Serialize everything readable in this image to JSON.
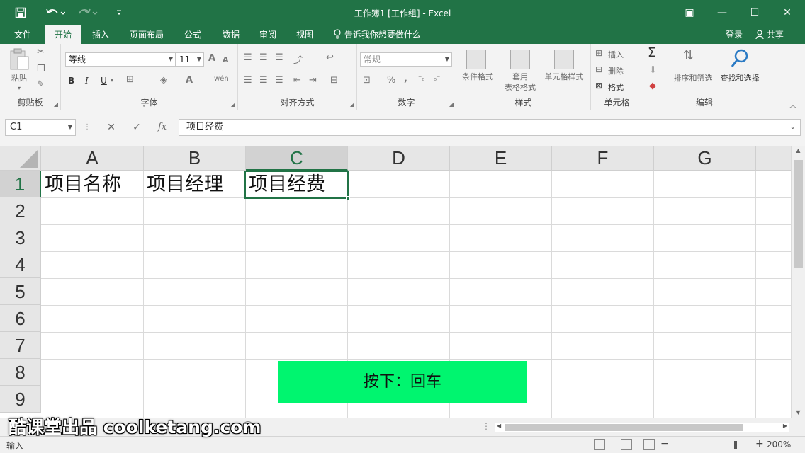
{
  "window": {
    "title": "工作簿1  [工作组] - Excel",
    "quick_access": {
      "save_icon": "save-icon",
      "undo_icon": "undo-icon",
      "redo_icon": "redo-icon",
      "customize_icon": "customize-icon"
    },
    "controls": {
      "ribbon_options": "▣",
      "minimize": "—",
      "maximize": "☐",
      "close": "✕"
    }
  },
  "menu": {
    "tabs": [
      "文件",
      "开始",
      "插入",
      "页面布局",
      "公式",
      "数据",
      "审阅",
      "视图"
    ],
    "active_tab": "开始",
    "tell_me": "告诉我你想要做什么",
    "login": "登录",
    "share": "共享"
  },
  "ribbon": {
    "clipboard": {
      "label": "剪贴板",
      "paste": "粘贴"
    },
    "font": {
      "label": "字体",
      "font_name": "等线",
      "font_size": "11",
      "bold": "B",
      "italic": "I",
      "underline": "U",
      "grow": "A",
      "shrink": "A",
      "font_color": "A",
      "phonetic": "wén"
    },
    "alignment": {
      "label": "对齐方式"
    },
    "number": {
      "label": "数字",
      "format": "常规",
      "percent": "%",
      "comma": ","
    },
    "styles": {
      "label": "样式",
      "conditional": "条件格式",
      "table_format_1": "套用",
      "table_format_2": "表格格式",
      "cell_styles": "单元格样式"
    },
    "cells": {
      "label": "单元格",
      "insert": "插入",
      "delete": "删除",
      "format": "格式"
    },
    "editing": {
      "label": "编辑",
      "sort_filter": "排序和筛选",
      "find_select": "查找和选择",
      "sum": "Σ"
    }
  },
  "formula_bar": {
    "name_box": "C1",
    "cancel": "✕",
    "enter": "✓",
    "fx": "fx",
    "content": "项目经费"
  },
  "sheet": {
    "columns": [
      "A",
      "B",
      "C",
      "D",
      "E",
      "F",
      "G"
    ],
    "rows": [
      "1",
      "2",
      "3",
      "4",
      "5",
      "6",
      "7",
      "8",
      "9"
    ],
    "selected_cell": "C1",
    "cells": {
      "A1": "项目名称",
      "B1": "项目经理",
      "C1": "项目经费"
    }
  },
  "status": {
    "mode": "输入",
    "zoom": "200%",
    "zoom_minus": "−",
    "zoom_plus": "+"
  },
  "overlay": {
    "key_hint": "按下：回车",
    "watermark": "酷课堂出品 coolketang.com"
  },
  "colors": {
    "accent": "#217346",
    "hint_bg": "#00f56f"
  }
}
